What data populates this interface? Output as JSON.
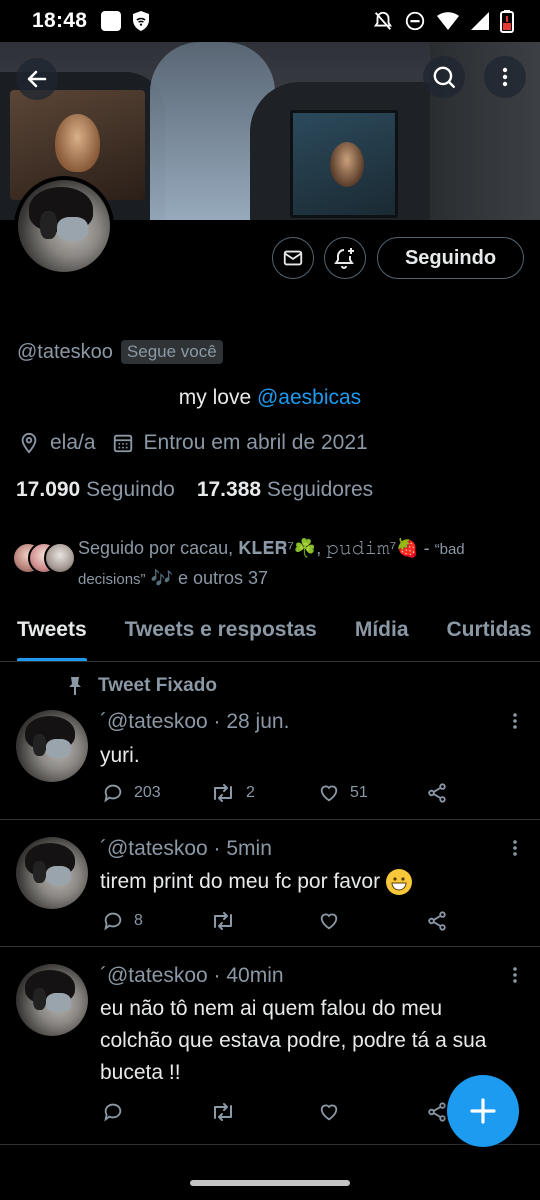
{
  "status_bar": {
    "time": "18:48"
  },
  "profile": {
    "handle": "@tateskoo",
    "follows_you": "Segue você",
    "bio_prefix": "my love ",
    "bio_mention": "@aesbicas",
    "pronouns": "ela/a",
    "joined": "Entrou em abril de 2021",
    "following_count": "17.090",
    "following_label": "Seguindo",
    "followers_count": "17.388",
    "followers_label": "Seguidores",
    "follow_button": "Seguindo"
  },
  "followed_by": {
    "line1": "Seguido por cacau, 𝐊𝐋𝐄𝐑⁷☘️, 𝚙𝚞𝚍𝚒𝚖⁷🍓 - ",
    "line1_small": "“bad",
    "line2_small": "decisions”",
    "line2": " 🎶 e outros 37"
  },
  "tabs": [
    {
      "label": "Tweets",
      "active": true
    },
    {
      "label": "Tweets e respostas",
      "active": false
    },
    {
      "label": "Mídia",
      "active": false
    },
    {
      "label": "Curtidas",
      "active": false
    }
  ],
  "pinned_label": "Tweet Fixado",
  "tweets": [
    {
      "head": "´@tateskoo · 28 jun.",
      "text": "yuri.",
      "replies": "203",
      "retweets": "2",
      "likes": "51"
    },
    {
      "head": "´@tateskoo · 5min",
      "text": "tirem print do meu fc por favor",
      "replies": "8",
      "retweets": "",
      "likes": ""
    },
    {
      "head": "´@tateskoo · 40min",
      "text": "eu não tô nem ai quem falou do meu colchão que estava podre, podre tá a sua buceta !!",
      "replies": "",
      "retweets": "",
      "likes": ""
    }
  ],
  "colors": {
    "accent": "#1d9bf0",
    "muted": "#8b98a5",
    "border": "#2f3336"
  }
}
